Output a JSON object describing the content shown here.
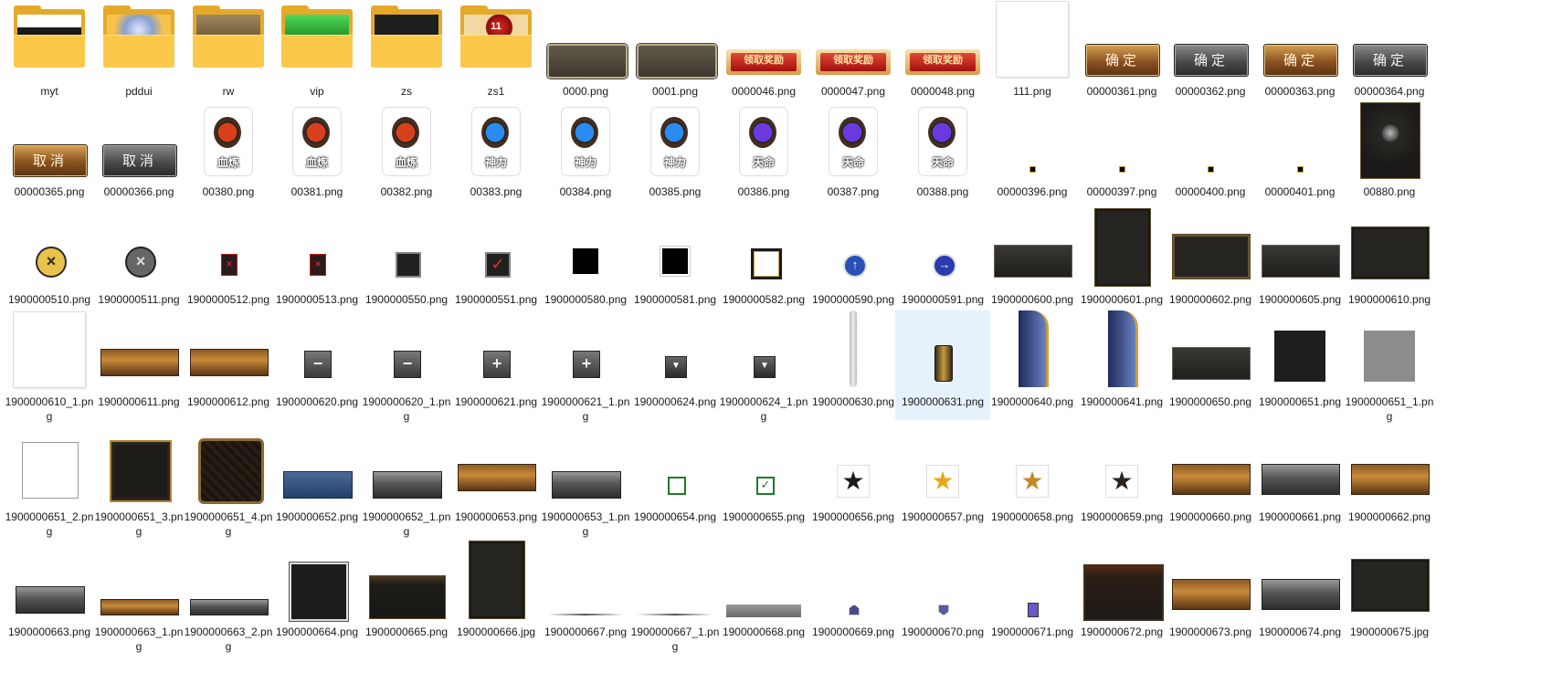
{
  "files": [
    {
      "name": "myt",
      "kind": "folder",
      "preview": "banner-dark"
    },
    {
      "name": "pddui",
      "kind": "folder",
      "preview": "sparkle"
    },
    {
      "name": "rw",
      "kind": "folder",
      "preview": "brown"
    },
    {
      "name": "vip",
      "kind": "folder",
      "preview": "green"
    },
    {
      "name": "zs",
      "kind": "folder",
      "preview": "black"
    },
    {
      "name": "zs1",
      "kind": "folder",
      "preview": "red-ball",
      "badge": "11"
    },
    {
      "name": "0000.png",
      "kind": "bar-metal"
    },
    {
      "name": "0001.png",
      "kind": "bar-metal"
    },
    {
      "name": "0000046.png",
      "kind": "btn-red",
      "label": "领取奖励"
    },
    {
      "name": "0000047.png",
      "kind": "btn-red",
      "label": "领取奖励"
    },
    {
      "name": "0000048.png",
      "kind": "btn-red",
      "label": "领取奖励"
    },
    {
      "name": "111.png",
      "kind": "blank-page"
    },
    {
      "name": "00000361.png",
      "kind": "btn-gold",
      "label": "确定"
    },
    {
      "name": "00000362.png",
      "kind": "btn-gray",
      "label": "确定"
    },
    {
      "name": "00000363.png",
      "kind": "btn-gold",
      "label": "确定"
    },
    {
      "name": "00000364.png",
      "kind": "btn-gray",
      "label": "确定"
    },
    {
      "name": "00000365.png",
      "kind": "btn-gold",
      "label": "取消"
    },
    {
      "name": "00000366.png",
      "kind": "btn-gray",
      "label": "取消"
    },
    {
      "name": "00380.png",
      "kind": "emblem",
      "color": "#d8401c",
      "label": "血炼"
    },
    {
      "name": "00381.png",
      "kind": "emblem",
      "color": "#d8401c",
      "label": "血炼"
    },
    {
      "name": "00382.png",
      "kind": "emblem",
      "color": "#d8401c",
      "label": "血炼"
    },
    {
      "name": "00383.png",
      "kind": "emblem",
      "color": "#2a8cf0",
      "label": "神力"
    },
    {
      "name": "00384.png",
      "kind": "emblem",
      "color": "#2a8cf0",
      "label": "神力"
    },
    {
      "name": "00385.png",
      "kind": "emblem",
      "color": "#2a8cf0",
      "label": "神力"
    },
    {
      "name": "00386.png",
      "kind": "emblem",
      "color": "#6a3ae0",
      "label": "天命"
    },
    {
      "name": "00387.png",
      "kind": "emblem",
      "color": "#6a3ae0",
      "label": "天命"
    },
    {
      "name": "00388.png",
      "kind": "emblem",
      "color": "#6a3ae0",
      "label": "天命"
    },
    {
      "name": "00000396.png",
      "kind": "dot"
    },
    {
      "name": "00000397.png",
      "kind": "dot"
    },
    {
      "name": "00000400.png",
      "kind": "dot"
    },
    {
      "name": "00000401.png",
      "kind": "dot"
    },
    {
      "name": "00880.png",
      "kind": "ornate-panel"
    },
    {
      "name": "1900000510.png",
      "kind": "close-round"
    },
    {
      "name": "1900000511.png",
      "kind": "close-round-gray"
    },
    {
      "name": "1900000512.png",
      "kind": "red-x-small"
    },
    {
      "name": "1900000513.png",
      "kind": "red-x-small"
    },
    {
      "name": "1900000550.png",
      "kind": "checkbox-dark"
    },
    {
      "name": "1900000551.png",
      "kind": "checkbox-checked"
    },
    {
      "name": "1900000580.png",
      "kind": "square-black"
    },
    {
      "name": "1900000581.png",
      "kind": "square-black-framed"
    },
    {
      "name": "1900000582.png",
      "kind": "square-hollow"
    },
    {
      "name": "1900000590.png",
      "kind": "arrow-up-round"
    },
    {
      "name": "1900000591.png",
      "kind": "arrow-right-round"
    },
    {
      "name": "1900000600.png",
      "kind": "dark-bar-wide"
    },
    {
      "name": "1900000601.png",
      "kind": "dark-tall"
    },
    {
      "name": "1900000602.png",
      "kind": "dark-frame-wide"
    },
    {
      "name": "1900000605.png",
      "kind": "dark-bar-wide"
    },
    {
      "name": "1900000610.png",
      "kind": "dark-box"
    },
    {
      "name": "1900000610_1.png",
      "kind": "blank-page"
    },
    {
      "name": "1900000611.png",
      "kind": "bronze-bar"
    },
    {
      "name": "1900000612.png",
      "kind": "bronze-bar"
    },
    {
      "name": "1900000620.png",
      "kind": "minus-button"
    },
    {
      "name": "1900000620_1.png",
      "kind": "minus-button"
    },
    {
      "name": "1900000621.png",
      "kind": "plus-button"
    },
    {
      "name": "1900000621_1.png",
      "kind": "plus-button"
    },
    {
      "name": "1900000624.png",
      "kind": "dropdown-button"
    },
    {
      "name": "1900000624_1.png",
      "kind": "dropdown-button"
    },
    {
      "name": "1900000630.png",
      "kind": "scroll-track"
    },
    {
      "name": "1900000631.png",
      "kind": "scroll-thumb",
      "selected": true
    },
    {
      "name": "1900000640.png",
      "kind": "blue-curved"
    },
    {
      "name": "1900000641.png",
      "kind": "blue-curved"
    },
    {
      "name": "1900000650.png",
      "kind": "dark-bar-wide"
    },
    {
      "name": "1900000651.png",
      "kind": "square-dark"
    },
    {
      "name": "1900000651_1.png",
      "kind": "square-gray"
    },
    {
      "name": "1900000651_2.png",
      "kind": "square-white"
    },
    {
      "name": "1900000651_3.png",
      "kind": "frame-gold-corners"
    },
    {
      "name": "1900000651_4.png",
      "kind": "frame-ornate"
    },
    {
      "name": "1900000652.png",
      "kind": "blue-bar"
    },
    {
      "name": "1900000652_1.png",
      "kind": "gray-bar"
    },
    {
      "name": "1900000653.png",
      "kind": "bronze-bar"
    },
    {
      "name": "1900000653_1.png",
      "kind": "gray-bar"
    },
    {
      "name": "1900000654.png",
      "kind": "checkbox-green"
    },
    {
      "name": "1900000655.png",
      "kind": "checkbox-green-checked"
    },
    {
      "name": "1900000656.png",
      "kind": "star-dark"
    },
    {
      "name": "1900000657.png",
      "kind": "star-gold"
    },
    {
      "name": "1900000658.png",
      "kind": "star-badge"
    },
    {
      "name": "1900000659.png",
      "kind": "star-badge-dark"
    },
    {
      "name": "1900000660.png",
      "kind": "bronze-bar-tall"
    },
    {
      "name": "1900000661.png",
      "kind": "gray-bar-tall"
    },
    {
      "name": "1900000662.png",
      "kind": "bronze-bar-tall"
    },
    {
      "name": "1900000663.png",
      "kind": "gray-bar"
    },
    {
      "name": "1900000663_1.png",
      "kind": "bronze-bar-thin"
    },
    {
      "name": "1900000663_2.png",
      "kind": "gray-bar-thin"
    },
    {
      "name": "1900000664.png",
      "kind": "square-dark-framed"
    },
    {
      "name": "1900000665.png",
      "kind": "dark-box-glow"
    },
    {
      "name": "1900000666.jpg",
      "kind": "dark-tall"
    },
    {
      "name": "1900000667.png",
      "kind": "thin-line"
    },
    {
      "name": "1900000667_1.png",
      "kind": "thin-line"
    },
    {
      "name": "1900000668.png",
      "kind": "gray-strip"
    },
    {
      "name": "1900000669.png",
      "kind": "tiny-house"
    },
    {
      "name": "1900000670.png",
      "kind": "tiny-shield"
    },
    {
      "name": "1900000671.png",
      "kind": "tiny-purple"
    },
    {
      "name": "1900000672.png",
      "kind": "ornate-chest"
    },
    {
      "name": "1900000673.png",
      "kind": "bronze-bar-tall"
    },
    {
      "name": "1900000674.png",
      "kind": "gray-bar-tall"
    },
    {
      "name": "1900000675.jpg",
      "kind": "dark-box"
    }
  ]
}
